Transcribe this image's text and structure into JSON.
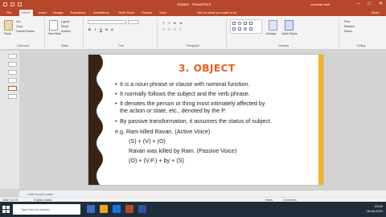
{
  "window": {
    "title": "classes - PowerPoint",
    "user": "namelan kath",
    "controls": [
      "–",
      "□",
      "✕"
    ]
  },
  "ribbon": {
    "tabs": [
      "File",
      "Home",
      "Insert",
      "Design",
      "Transitions",
      "Animations",
      "Slide Show",
      "Review",
      "View"
    ],
    "tell_me": "Tell me what you want to do",
    "share": "Share",
    "clipboard": {
      "paste": "Paste",
      "cut": "Cut",
      "copy": "Copy",
      "format_painter": "Format Painter",
      "label": "Clipboard"
    },
    "slides": {
      "new_slide": "New Slide",
      "layout": "Layout",
      "reset": "Reset",
      "section": "Section",
      "label": "Slides"
    },
    "font": {
      "label": "Font"
    },
    "paragraph": {
      "label": "Paragraph"
    },
    "drawing": {
      "arrange": "Arrange",
      "quick_styles": "Quick Styles",
      "label": "Drawing"
    },
    "editing": {
      "find": "Find",
      "replace": "Replace",
      "select": "Select",
      "label": "Editing"
    }
  },
  "slide": {
    "title": "3. OBJECT",
    "lines": [
      "It is a noun phrase or clause with nominal function.",
      "It normally follows the subject and the verb phrase.",
      "It denotes the person or thing most intimately affected by",
      "the action or state, etc., denoted by the P.",
      "By passive transformation, it assumes the status of subject.",
      "e.g. Ram killed Ravan. (Active Voice)",
      "(S) + (V) + (O)",
      "Ravan was killed by Ram. (Passive Voice)",
      "(O) + (V.P.) + by + (S)"
    ],
    "colors": {
      "title": "#e8601c",
      "left_border": "#3b2314",
      "right_border": "#f4b321"
    }
  },
  "notes": {
    "placeholder": "Click to add notes"
  },
  "status": {
    "slide_info": "Slide 9 of 20",
    "language": "English (India)",
    "notes_btn": "Notes",
    "comments_btn": "Comments"
  },
  "taskbar": {
    "search_placeholder": "Type here to search",
    "time": "23:00",
    "date": "28-08-2020"
  }
}
